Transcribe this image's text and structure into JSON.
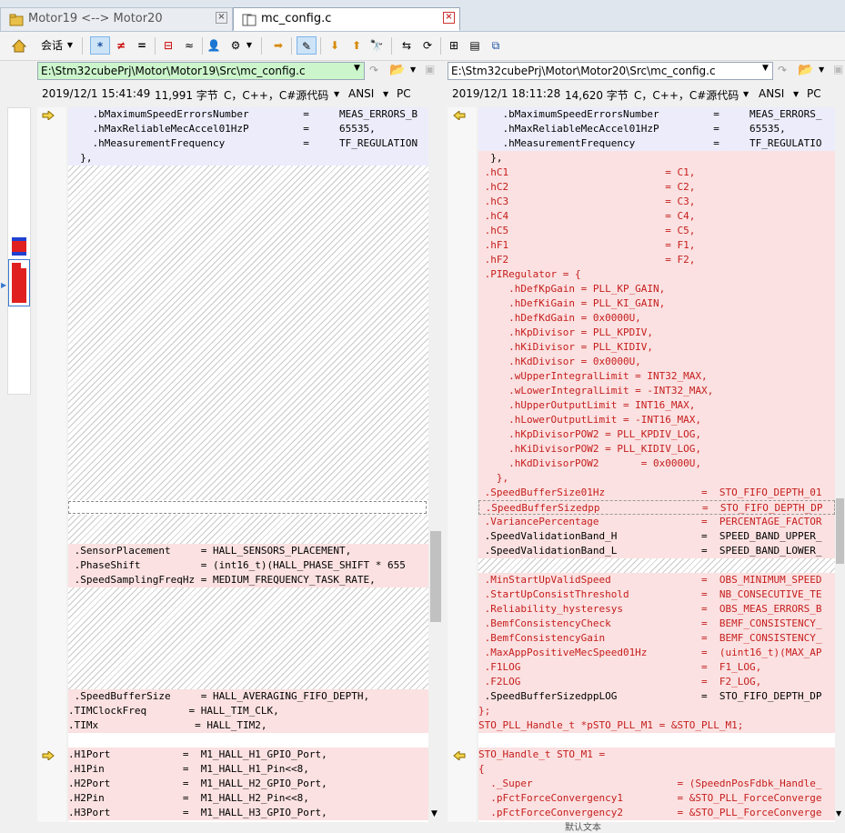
{
  "tabs": [
    {
      "label": "Motor19 <--> Motor20",
      "active": false
    },
    {
      "label": "mc_config.c",
      "active": true
    }
  ],
  "toolbar": {
    "session_label": "会话"
  },
  "left": {
    "path": "E:\\Stm32cubePrj\\Motor\\Motor19\\Src\\mc_config.c",
    "date": "2019/12/1 15:41:49",
    "size": "11,991 字节",
    "format": "C，C++，C#源代码",
    "encoding": "ANSI",
    "eol": "PC",
    "lines": [
      "    .bMaximumSpeedErrorsNumber         =     MEAS_ERRORS_B",
      "    .hMaxReliableMecAccel01HzP         =     65535,",
      "    .hMeasurementFrequency             =     TF_REGULATION",
      "  },",
      " .SensorPlacement     = HALL_SENSORS_PLACEMENT,",
      " .PhaseShift          = (int16_t)(HALL_PHASE_SHIFT * 655",
      " .SpeedSamplingFreqHz = MEDIUM_FREQUENCY_TASK_RATE,",
      " .SpeedBufferSize     = HALL_AVERAGING_FIFO_DEPTH,",
      ".TIMClockFreq       = HALL_TIM_CLK,",
      ".TIMx                = HALL_TIM2,",
      ".H1Port            =  M1_HALL_H1_GPIO_Port,",
      ".H1Pin             =  M1_HALL_H1_Pin<<8,",
      ".H2Port            =  M1_HALL_H2_GPIO_Port,",
      ".H2Pin             =  M1_HALL_H2_Pin<<8,",
      ".H3Port            =  M1_HALL_H3_GPIO_Port,"
    ]
  },
  "right": {
    "path": "E:\\Stm32cubePrj\\Motor\\Motor20\\Src\\mc_config.c",
    "date": "2019/12/1 18:11:28",
    "size": "14,620 字节",
    "format": "C，C++，C#源代码",
    "encoding": "ANSI",
    "eol": "PC",
    "lines": [
      "    .bMaximumSpeedErrorsNumber         =     MEAS_ERRORS_",
      "    .hMaxReliableMecAccel01HzP         =     65535,",
      "    .hMeasurementFrequency             =     TF_REGULATIO",
      "  },",
      " .hC1                          = C1,",
      " .hC2                          = C2,",
      " .hC3                          = C3,",
      " .hC4                          = C4,",
      " .hC5                          = C5,",
      " .hF1                          = F1,",
      " .hF2                          = F2,",
      " .PIRegulator = {",
      "     .hDefKpGain = PLL_KP_GAIN,",
      "     .hDefKiGain = PLL_KI_GAIN,",
      "     .hDefKdGain = 0x0000U,",
      "     .hKpDivisor = PLL_KPDIV,",
      "     .hKiDivisor = PLL_KIDIV,",
      "     .hKdDivisor = 0x0000U,",
      "     .wUpperIntegralLimit = INT32_MAX,",
      "     .wLowerIntegralLimit = -INT32_MAX,",
      "     .hUpperOutputLimit = INT16_MAX,",
      "     .hLowerOutputLimit = -INT16_MAX,",
      "     .hKpDivisorPOW2 = PLL_KPDIV_LOG,",
      "     .hKiDivisorPOW2 = PLL_KIDIV_LOG,",
      "     .hKdDivisorPOW2       = 0x0000U,",
      "   },",
      " .SpeedBufferSize01Hz                =  STO_FIFO_DEPTH_01",
      " .SpeedBufferSizedpp                 =  STO_FIFO_DEPTH_DP",
      " .VariancePercentage                 =  PERCENTAGE_FACTOR",
      " .SpeedValidationBand_H              =  SPEED_BAND_UPPER_",
      " .SpeedValidationBand_L              =  SPEED_BAND_LOWER_",
      " .MinStartUpValidSpeed               =  OBS_MINIMUM_SPEED",
      " .StartUpConsistThreshold            =  NB_CONSECUTIVE_TE",
      " .Reliability_hysteresys             =  OBS_MEAS_ERRORS_B",
      " .BemfConsistencyCheck               =  BEMF_CONSISTENCY_",
      " .BemfConsistencyGain                =  BEMF_CONSISTENCY_",
      " .MaxAppPositiveMecSpeed01Hz         =  (uint16_t)(MAX_AP",
      " .F1LOG                              =  F1_LOG,",
      " .F2LOG                              =  F2_LOG,",
      " .SpeedBufferSizedppLOG              =  STO_FIFO_DEPTH_DP",
      "};",
      "STO_PLL_Handle_t *pSTO_PLL_M1 = &STO_PLL_M1;",
      "STO_Handle_t STO_M1 =",
      "{",
      "  ._Super                        = (SpeednPosFdbk_Handle_",
      "  .pFctForceConvergency1         = &STO_PLL_ForceConverge",
      "  .pFctForceConvergency2         = &STO_PLL_ForceConverge"
    ]
  },
  "status": {
    "right_hint": "默认文本"
  },
  "colors": {
    "diff_bg": "#fbe1e1",
    "diff_fg": "#c61d1d",
    "same_bg": "#ececfb",
    "tab_bg": "#dfe6ee"
  }
}
